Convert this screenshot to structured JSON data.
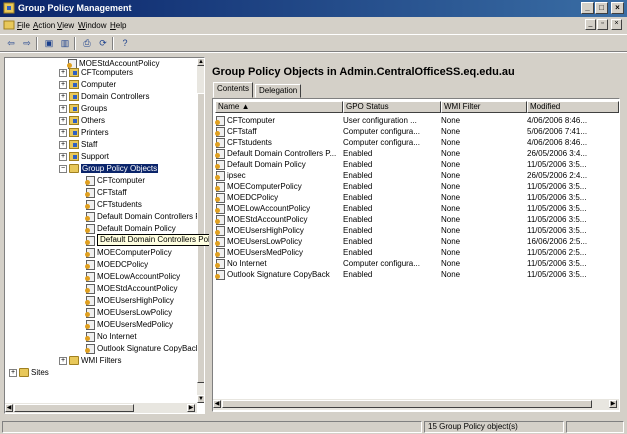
{
  "window": {
    "title": "Group Policy Management"
  },
  "menu": [
    {
      "label": "File",
      "u": "F"
    },
    {
      "label": "Action",
      "u": "A"
    },
    {
      "label": "View",
      "u": "V"
    },
    {
      "label": "Window",
      "u": "W"
    },
    {
      "label": "Help",
      "u": "H"
    }
  ],
  "toolbar": [
    "back-icon",
    "forward-icon",
    "up-folder-icon",
    "show-hide-tree-icon",
    "print-icon",
    "refresh-icon",
    "help-icon"
  ],
  "tree": {
    "items": [
      {
        "label": "MOEStdAccountPolicy",
        "icon": "gpo",
        "exp": ""
      },
      {
        "label": "CFTcomputers",
        "icon": "ou",
        "exp": "+"
      },
      {
        "label": "Computer",
        "icon": "ou",
        "exp": "+"
      },
      {
        "label": "Domain Controllers",
        "icon": "ou",
        "exp": "+"
      },
      {
        "label": "Groups",
        "icon": "ou",
        "exp": "+"
      },
      {
        "label": "Others",
        "icon": "ou",
        "exp": "+"
      },
      {
        "label": "Printers",
        "icon": "ou",
        "exp": "+"
      },
      {
        "label": "Staff",
        "icon": "ou",
        "exp": "+"
      },
      {
        "label": "Support",
        "icon": "ou",
        "exp": "+"
      },
      {
        "label": "Group Policy Objects",
        "icon": "folder",
        "exp": "−",
        "selected": true
      },
      {
        "label": "CFTcomputer",
        "icon": "gpo",
        "exp": ""
      },
      {
        "label": "CFTstaff",
        "icon": "gpo",
        "exp": ""
      },
      {
        "label": "CFTstudents",
        "icon": "gpo",
        "exp": ""
      },
      {
        "label": "Default Domain Controllers Policy",
        "icon": "gpo",
        "exp": ""
      },
      {
        "label": "Default Domain Policy",
        "icon": "gpo",
        "exp": ""
      },
      {
        "label": "ipsec",
        "icon": "gpo",
        "exp": ""
      },
      {
        "label": "MOEComputerPolicy",
        "icon": "gpo",
        "exp": ""
      },
      {
        "label": "MOEDCPolicy",
        "icon": "gpo",
        "exp": ""
      },
      {
        "label": "MOELowAccountPolicy",
        "icon": "gpo",
        "exp": ""
      },
      {
        "label": "MOEStdAccountPolicy",
        "icon": "gpo",
        "exp": ""
      },
      {
        "label": "MOEUsersHighPolicy",
        "icon": "gpo",
        "exp": ""
      },
      {
        "label": "MOEUsersLowPolicy",
        "icon": "gpo",
        "exp": ""
      },
      {
        "label": "MOEUsersMedPolicy",
        "icon": "gpo",
        "exp": ""
      },
      {
        "label": "No Internet",
        "icon": "gpo",
        "exp": ""
      },
      {
        "label": "Outlook Signature CopyBack",
        "icon": "gpo",
        "exp": ""
      },
      {
        "label": "WMI Filters",
        "icon": "folder",
        "exp": "+"
      },
      {
        "label": "Sites",
        "icon": "folder",
        "exp": "+"
      }
    ],
    "tooltip": "Default Domain Controllers Policy"
  },
  "panel": {
    "title": "Group Policy Objects in Admin.CentralOfficeSS.eq.edu.au",
    "tabs": [
      "Contents",
      "Delegation"
    ],
    "columns": [
      "Name",
      "GPO Status",
      "WMI Filter",
      "Modified"
    ],
    "rows": [
      [
        "CFTcomputer",
        "User configuration ...",
        "None",
        "4/06/2006 8:46..."
      ],
      [
        "CFTstaff",
        "Computer configura...",
        "None",
        "5/06/2006 7:41..."
      ],
      [
        "CFTstudents",
        "Computer configura...",
        "None",
        "4/06/2006 8:46..."
      ],
      [
        "Default Domain Controllers P...",
        "Enabled",
        "None",
        "26/05/2006 3:4..."
      ],
      [
        "Default Domain Policy",
        "Enabled",
        "None",
        "11/05/2006 3:5..."
      ],
      [
        "ipsec",
        "Enabled",
        "None",
        "26/05/2006 2:4..."
      ],
      [
        "MOEComputerPolicy",
        "Enabled",
        "None",
        "11/05/2006 3:5..."
      ],
      [
        "MOEDCPolicy",
        "Enabled",
        "None",
        "11/05/2006 3:5..."
      ],
      [
        "MOELowAccountPolicy",
        "Enabled",
        "None",
        "11/05/2006 3:5..."
      ],
      [
        "MOEStdAccountPolicy",
        "Enabled",
        "None",
        "11/05/2006 3:5..."
      ],
      [
        "MOEUsersHighPolicy",
        "Enabled",
        "None",
        "11/05/2006 3:5..."
      ],
      [
        "MOEUsersLowPolicy",
        "Enabled",
        "None",
        "16/06/2006 2:5..."
      ],
      [
        "MOEUsersMedPolicy",
        "Enabled",
        "None",
        "11/05/2006 2:5..."
      ],
      [
        "No Internet",
        "Computer configura...",
        "None",
        "11/05/2006 3:5..."
      ],
      [
        "Outlook Signature CopyBack",
        "Enabled",
        "None",
        "11/05/2006 3:5..."
      ]
    ]
  },
  "status": {
    "text": "15 Group Policy object(s)"
  }
}
